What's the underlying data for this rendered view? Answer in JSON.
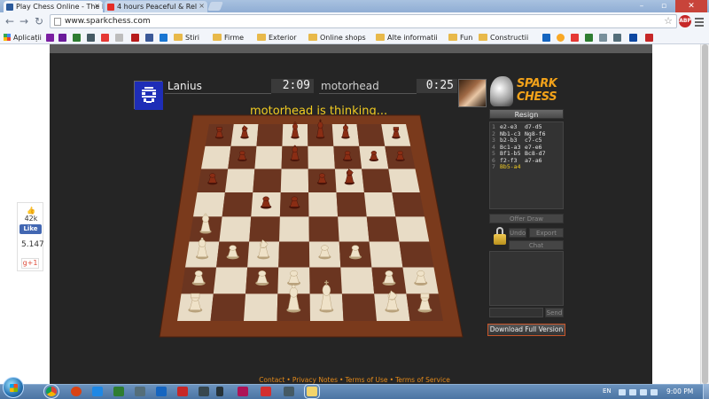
{
  "browser": {
    "tabs": [
      {
        "title": "Play Chess Online - The P",
        "active": true,
        "favicon_color": "#2b5a9b"
      },
      {
        "title": "4 hours Peaceful & Rel",
        "active": false,
        "favicon_color": "#e52d27"
      }
    ],
    "url": "www.sparkchess.com",
    "abp_label": "ABP",
    "bookmarks": [
      {
        "label": "Aplicații",
        "icon": "apps-grid-icon"
      },
      {
        "label": "Stiri",
        "icon": "folder-icon"
      },
      {
        "label": "Firme",
        "icon": "folder-icon"
      },
      {
        "label": "Exterior",
        "icon": "folder-icon"
      },
      {
        "label": "Online shops",
        "icon": "folder-icon"
      },
      {
        "label": "Alte informatii",
        "icon": "folder-icon"
      },
      {
        "label": "Fun",
        "icon": "folder-icon"
      },
      {
        "label": "Constructii",
        "icon": "folder-icon"
      }
    ]
  },
  "social": {
    "likes": "42k",
    "fb_label": "Like",
    "shares": "5.147",
    "gplus_label": "g+1"
  },
  "game": {
    "player1": {
      "name": "Lanius",
      "clock": "2:09"
    },
    "player2": {
      "name": "motorhead",
      "clock": "0:25"
    },
    "logo_line1": "SPARK",
    "logo_line2": "CHESS",
    "status": "motorhead is thinking...",
    "resign_label": "Resign",
    "moves": [
      {
        "num": "1",
        "white": "e2-e3",
        "black": "d7-d5"
      },
      {
        "num": "2",
        "white": "Nb1-c3",
        "black": "Ng8-f6"
      },
      {
        "num": "3",
        "white": "b2-b3",
        "black": "c7-c5"
      },
      {
        "num": "4",
        "white": "Bc1-a3",
        "black": "e7-e6"
      },
      {
        "num": "5",
        "white": "Bf1-b5",
        "black": "Bc8-d7"
      },
      {
        "num": "6",
        "white": "f2-f3",
        "black": "a7-a6"
      },
      {
        "num": "7",
        "white": "Bb5-a4",
        "black": ""
      }
    ],
    "offer_draw_label": "Offer Draw",
    "undo_label": "Undo",
    "export_label": "Export PGN",
    "chat_label": "Chat",
    "send_label": "Send",
    "download_label": "Download Full Version"
  },
  "board": {
    "light_square": "#e8dcc6",
    "dark_square": "#6b3520",
    "frame_color": "#7a3a1c",
    "white_pieces": [
      {
        "type": "bishop",
        "square": "a4"
      },
      {
        "type": "pawn",
        "square": "a2"
      },
      {
        "type": "pawn",
        "square": "b3"
      },
      {
        "type": "pawn",
        "square": "c2"
      },
      {
        "type": "pawn",
        "square": "d2"
      },
      {
        "type": "pawn",
        "square": "e3"
      },
      {
        "type": "pawn",
        "square": "f3"
      },
      {
        "type": "pawn",
        "square": "g2"
      },
      {
        "type": "pawn",
        "square": "h2"
      },
      {
        "type": "knight",
        "square": "c3"
      },
      {
        "type": "bishop",
        "square": "a3"
      },
      {
        "type": "rook",
        "square": "a1"
      },
      {
        "type": "queen",
        "square": "d1"
      },
      {
        "type": "king",
        "square": "e1"
      },
      {
        "type": "knight",
        "square": "g1"
      },
      {
        "type": "rook",
        "square": "h1"
      }
    ],
    "black_pieces": [
      {
        "type": "rook",
        "square": "a8"
      },
      {
        "type": "knight",
        "square": "b8"
      },
      {
        "type": "queen",
        "square": "d8"
      },
      {
        "type": "king",
        "square": "e8"
      },
      {
        "type": "bishop",
        "square": "f8"
      },
      {
        "type": "rook",
        "square": "h8"
      },
      {
        "type": "pawn",
        "square": "b7"
      },
      {
        "type": "bishop",
        "square": "d7"
      },
      {
        "type": "pawn",
        "square": "f7"
      },
      {
        "type": "pawn",
        "square": "g7"
      },
      {
        "type": "pawn",
        "square": "h7"
      },
      {
        "type": "pawn",
        "square": "a6"
      },
      {
        "type": "pawn",
        "square": "e6"
      },
      {
        "type": "knight",
        "square": "f6"
      },
      {
        "type": "pawn",
        "square": "c5"
      },
      {
        "type": "pawn",
        "square": "d5"
      }
    ]
  },
  "footer": {
    "links": [
      "Contact",
      "Privacy Notes",
      "Terms of Use",
      "Terms of Service"
    ]
  },
  "taskbar": {
    "lang": "EN",
    "time": "9:00 PM",
    "apps": [
      "chrome-icon",
      "app-icon-2",
      "app-icon-3",
      "app-icon-4",
      "app-icon-5",
      "app-icon-6",
      "app-icon-7",
      "app-icon-8",
      "app-icon-9",
      "app-icon-10",
      "app-icon-11",
      "app-icon-12",
      "app-icon-13"
    ]
  }
}
